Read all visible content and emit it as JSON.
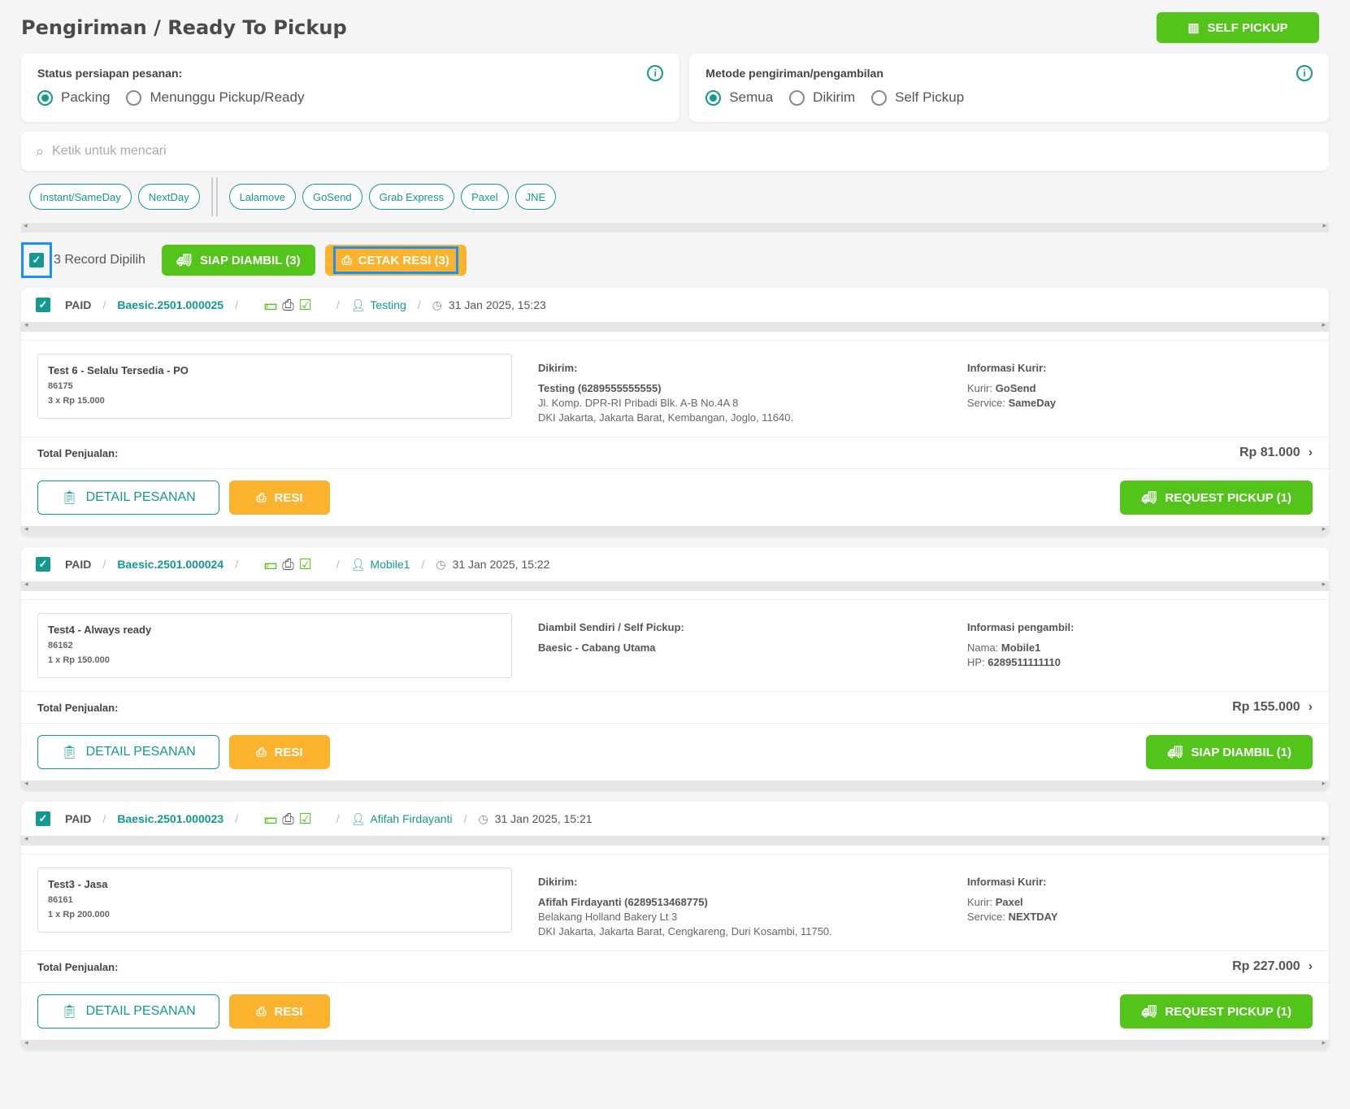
{
  "page": {
    "title": "Pengiriman / Ready To Pickup",
    "self_pickup_label": "SELF PICKUP"
  },
  "filters": {
    "status": {
      "title": "Status persiapan pesanan:",
      "options": [
        "Packing",
        "Menunggu Pickup/Ready"
      ],
      "selected": "Packing"
    },
    "method": {
      "title": "Metode pengiriman/pengambilan",
      "options": [
        "Semua",
        "Dikirim",
        "Self Pickup"
      ],
      "selected": "Semua"
    }
  },
  "search": {
    "placeholder": "Ketik untuk mencari"
  },
  "chips": {
    "left": [
      "Instant/SameDay",
      "NextDay"
    ],
    "right": [
      "Lalamove",
      "GoSend",
      "Grab Express",
      "Paxel",
      "JNE"
    ]
  },
  "bulk": {
    "label": "3 Record Dipilih",
    "siap_label": "SIAP DIAMBIL (3)",
    "cetak_label": "CETAK RESI (3)"
  },
  "orders": [
    {
      "status": "PAID",
      "order_no": "Baesic.2501.000025",
      "user": "Testing",
      "time": "31 Jan 2025, 15:23",
      "product": {
        "name": "Test 6 - Selalu Tersedia - PO",
        "sku": "86175",
        "qty": "3 x Rp 15.000"
      },
      "ship": {
        "label": "Dikirim:",
        "name": "Testing (6289555555555)",
        "addr1": "Jl. Komp. DPR-RI Pribadi Blk. A-B No.4A 8",
        "addr2": "DKI Jakarta, Jakarta Barat, Kembangan, Joglo, 11640."
      },
      "info": {
        "label": "Informasi Kurir:",
        "k1": "Kurir:",
        "v1": "GoSend",
        "k2": "Service:",
        "v2": "SameDay"
      },
      "total_label": "Total Penjualan:",
      "total": "Rp 81.000",
      "detail_label": "DETAIL PESANAN",
      "resi_label": "RESI",
      "action_label": "REQUEST PICKUP (1)"
    },
    {
      "status": "PAID",
      "order_no": "Baesic.2501.000024",
      "user": "Mobile1",
      "time": "31 Jan 2025, 15:22",
      "product": {
        "name": "Test4 - Always ready",
        "sku": "86162",
        "qty": "1 x Rp 150.000"
      },
      "ship": {
        "label": "Diambil Sendiri / Self Pickup:",
        "name": "Baesic - Cabang Utama",
        "addr1": "",
        "addr2": ""
      },
      "info": {
        "label": "Informasi pengambil:",
        "k1": "Nama:",
        "v1": "Mobile1",
        "k2": "HP:",
        "v2": "6289511111110"
      },
      "total_label": "Total Penjualan:",
      "total": "Rp 155.000",
      "detail_label": "DETAIL PESANAN",
      "resi_label": "RESI",
      "action_label": "SIAP DIAMBIL (1)"
    },
    {
      "status": "PAID",
      "order_no": "Baesic.2501.000023",
      "user": "Afifah Firdayanti",
      "time": "31 Jan 2025, 15:21",
      "product": {
        "name": "Test3 - Jasa",
        "sku": "86161",
        "qty": "1 x Rp 200.000"
      },
      "ship": {
        "label": "Dikirim:",
        "name": "Afifah Firdayanti (6289513468775)",
        "addr1": "Belakang Holland Bakery Lt 3",
        "addr2": "DKI Jakarta, Jakarta Barat, Cengkareng, Duri Kosambi, 11750."
      },
      "info": {
        "label": "Informasi Kurir:",
        "k1": "Kurir:",
        "v1": "Paxel",
        "k2": "Service:",
        "v2": "NEXTDAY"
      },
      "total_label": "Total Penjualan:",
      "total": "Rp 227.000",
      "detail_label": "DETAIL PESANAN",
      "resi_label": "RESI",
      "action_label": "REQUEST PICKUP (1)"
    }
  ],
  "colors": {
    "primary": "#13998f",
    "green": "#52c41a",
    "orange": "#fbb22c",
    "highlight": "#1890ff"
  }
}
